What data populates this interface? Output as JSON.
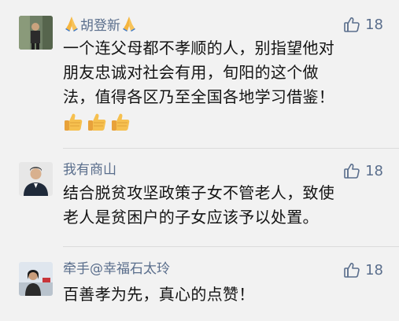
{
  "comments": [
    {
      "username": "胡登新",
      "likes": "18",
      "lines": [
        "一个连父母都不孝顺的人，别指望他对",
        "朋友忠诚对社会有用，旬阳的这个做",
        "法，值得各区乃至全国各地学习借鉴！"
      ],
      "emoji": "thumbs-up x3"
    },
    {
      "username": "我有商山",
      "likes": "18",
      "lines": [
        "结合脱贫攻坚政策子女不管老人，致使",
        "老人是贫困户的子女应该予以处置。"
      ]
    },
    {
      "username": "牵手@幸福石太玲",
      "likes": "18",
      "lines": [
        "百善孝为先，真心的点赞！"
      ]
    }
  ],
  "colors": {
    "username": "#5a6e8c",
    "text": "#141414",
    "background": "#f2f2f2"
  },
  "icons": [
    "praying-hands-icon",
    "thumbs-up-icon",
    "thumbs-up-outline-icon"
  ]
}
